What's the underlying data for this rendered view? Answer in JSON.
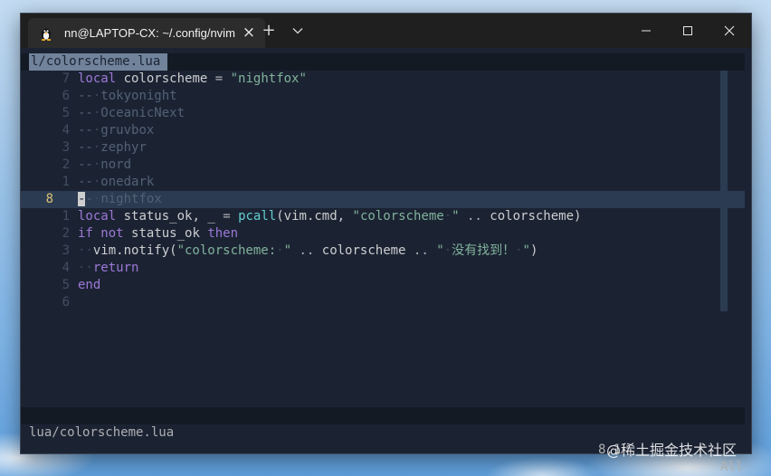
{
  "window": {
    "tab_title": "nn@LAPTOP-CX: ~/.config/nvim",
    "close_tab_glyph": "×",
    "new_tab_glyph": "+",
    "icons": [
      "linux-penguin-icon",
      "close-icon",
      "plus-icon",
      "chevron-down-icon",
      "minimize-icon",
      "maximize-icon",
      "close-icon"
    ]
  },
  "editor": {
    "buffer_name": "l/colorscheme.lua",
    "lines": [
      {
        "num": "7",
        "current": false,
        "segments": [
          {
            "t": "local",
            "c": "k"
          },
          {
            "t": " ",
            "c": "i"
          },
          {
            "t": "colorscheme",
            "c": "i"
          },
          {
            "t": " ",
            "c": "i"
          },
          {
            "t": "=",
            "c": "o"
          },
          {
            "t": " ",
            "c": "i"
          },
          {
            "t": "\"nightfox\"",
            "c": "s"
          }
        ]
      },
      {
        "num": "6",
        "current": false,
        "segments": [
          {
            "t": "--",
            "c": "c"
          },
          {
            "t": "·",
            "c": "d"
          },
          {
            "t": "tokyonight",
            "c": "c"
          }
        ]
      },
      {
        "num": "5",
        "current": false,
        "segments": [
          {
            "t": "--",
            "c": "c"
          },
          {
            "t": "·",
            "c": "d"
          },
          {
            "t": "OceanicNext",
            "c": "c"
          }
        ]
      },
      {
        "num": "4",
        "current": false,
        "segments": [
          {
            "t": "--",
            "c": "c"
          },
          {
            "t": "·",
            "c": "d"
          },
          {
            "t": "gruvbox",
            "c": "c"
          }
        ]
      },
      {
        "num": "3",
        "current": false,
        "segments": [
          {
            "t": "--",
            "c": "c"
          },
          {
            "t": "·",
            "c": "d"
          },
          {
            "t": "zephyr",
            "c": "c"
          }
        ]
      },
      {
        "num": "2",
        "current": false,
        "segments": [
          {
            "t": "--",
            "c": "c"
          },
          {
            "t": "·",
            "c": "d"
          },
          {
            "t": "nord",
            "c": "c"
          }
        ]
      },
      {
        "num": "1",
        "current": false,
        "segments": [
          {
            "t": "--",
            "c": "c"
          },
          {
            "t": "·",
            "c": "d"
          },
          {
            "t": "onedark",
            "c": "c"
          }
        ]
      },
      {
        "num": "8",
        "current": true,
        "segments": [
          {
            "t": "-",
            "c": "cursor"
          },
          {
            "t": "-",
            "c": "c"
          },
          {
            "t": "·",
            "c": "d"
          },
          {
            "t": "nightfox",
            "c": "c"
          }
        ]
      },
      {
        "num": "1",
        "current": false,
        "segments": [
          {
            "t": "local",
            "c": "k"
          },
          {
            "t": " ",
            "c": "i"
          },
          {
            "t": "status_ok,",
            "c": "i"
          },
          {
            "t": " ",
            "c": "i"
          },
          {
            "t": "_",
            "c": "i"
          },
          {
            "t": " ",
            "c": "i"
          },
          {
            "t": "=",
            "c": "o"
          },
          {
            "t": " ",
            "c": "i"
          },
          {
            "t": "pcall",
            "c": "f"
          },
          {
            "t": "(vim.cmd,",
            "c": "i"
          },
          {
            "t": " ",
            "c": "i"
          },
          {
            "t": "\"colorscheme",
            "c": "s"
          },
          {
            "t": "·",
            "c": "d"
          },
          {
            "t": "\"",
            "c": "s"
          },
          {
            "t": " ",
            "c": "i"
          },
          {
            "t": "..",
            "c": "o"
          },
          {
            "t": " ",
            "c": "i"
          },
          {
            "t": "colorscheme)",
            "c": "i"
          }
        ]
      },
      {
        "num": "2",
        "current": false,
        "segments": [
          {
            "t": "if",
            "c": "k"
          },
          {
            "t": " ",
            "c": "i"
          },
          {
            "t": "not",
            "c": "k"
          },
          {
            "t": " ",
            "c": "i"
          },
          {
            "t": "status_ok",
            "c": "i"
          },
          {
            "t": " ",
            "c": "i"
          },
          {
            "t": "then",
            "c": "k"
          }
        ]
      },
      {
        "num": "3",
        "current": false,
        "segments": [
          {
            "t": "··",
            "c": "d"
          },
          {
            "t": "vim.notify(",
            "c": "i"
          },
          {
            "t": "\"colorscheme:",
            "c": "s"
          },
          {
            "t": "·",
            "c": "d"
          },
          {
            "t": "\"",
            "c": "s"
          },
          {
            "t": " ",
            "c": "i"
          },
          {
            "t": "..",
            "c": "o"
          },
          {
            "t": " ",
            "c": "i"
          },
          {
            "t": "colorscheme",
            "c": "i"
          },
          {
            "t": " ",
            "c": "i"
          },
          {
            "t": "..",
            "c": "o"
          },
          {
            "t": " ",
            "c": "i"
          },
          {
            "t": "\"",
            "c": "s"
          },
          {
            "t": "·",
            "c": "d"
          },
          {
            "t": "没有找到！",
            "c": "s"
          },
          {
            "t": "·",
            "c": "d"
          },
          {
            "t": "\"",
            "c": "s"
          },
          {
            "t": ")",
            "c": "i"
          }
        ]
      },
      {
        "num": "4",
        "current": false,
        "segments": [
          {
            "t": "··",
            "c": "d"
          },
          {
            "t": "return",
            "c": "k"
          }
        ]
      },
      {
        "num": "5",
        "current": false,
        "segments": [
          {
            "t": "end",
            "c": "k"
          }
        ]
      },
      {
        "num": "6",
        "current": false,
        "segments": []
      }
    ]
  },
  "statusline": {
    "file": "lua/colorscheme.lua",
    "position": "8,1",
    "scroll": "All"
  },
  "watermark": "@稀土掘金技术社区",
  "colors": {
    "keyword": "#9d79d6",
    "string": "#81b29a",
    "function": "#63cdcf",
    "comment": "#526175",
    "background": "#1b2333",
    "cursorline": "#2b3b51"
  }
}
